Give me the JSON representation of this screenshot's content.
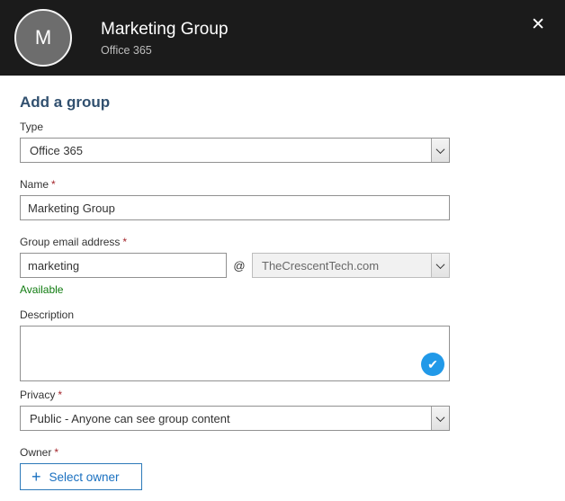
{
  "colors": {
    "header_bg": "#1b1b1b",
    "heading_text": "#31506f",
    "accent_blue": "#1a70c0",
    "available_green": "#107c10",
    "required_red": "#a4262c",
    "check_badge_blue": "#2199e8",
    "disabled_field_bg": "#f1f1f1"
  },
  "header": {
    "avatar_letter": "M",
    "title": "Marketing Group",
    "subtitle": "Office 365",
    "close_glyph": "✕"
  },
  "form": {
    "heading": "Add a group",
    "type": {
      "label": "Type",
      "value": "Office 365"
    },
    "name": {
      "label": "Name",
      "required_marker": "*",
      "value": "Marketing Group"
    },
    "email": {
      "label": "Group email address",
      "required_marker": "*",
      "local_part": "marketing",
      "at_symbol": "@",
      "domain": "TheCrescentTech.com",
      "availability_status": "Available"
    },
    "description": {
      "label": "Description",
      "value": "",
      "valid_glyph": "✔"
    },
    "privacy": {
      "label": "Privacy",
      "required_marker": "*",
      "value": "Public - Anyone can see group content"
    },
    "owner": {
      "label": "Owner",
      "required_marker": "*",
      "plus_glyph": "+",
      "button_label": "Select owner"
    }
  }
}
